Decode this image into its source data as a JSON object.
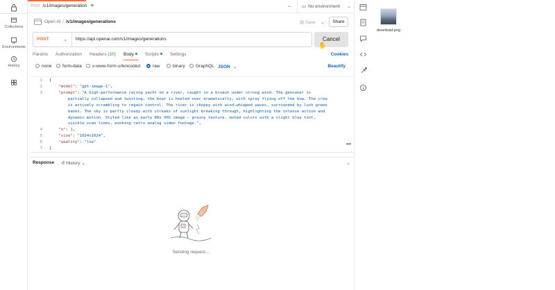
{
  "tabs": [
    {
      "method": "POST",
      "label": "/v1/images/generation"
    }
  ],
  "env": {
    "label": "No environment"
  },
  "rail": {
    "items": [
      {
        "label": "Collections"
      },
      {
        "label": "Environments"
      },
      {
        "label": "History"
      },
      {
        "label": ""
      }
    ]
  },
  "breadcrumb": {
    "workspace": "Open AI",
    "separator": "/",
    "request": "/v1/images/generations"
  },
  "toolbar": {
    "save_label": "Save",
    "share_label": "Share"
  },
  "request": {
    "method": "POST",
    "url": "https://api.openai.com/v1/images/generations",
    "cancel_label": "Cancel"
  },
  "request_tabs": {
    "params": "Params",
    "authorization": "Authorization",
    "headers": "Headers",
    "headers_count": "(10)",
    "body": "Body",
    "scripts": "Scripts",
    "settings": "Settings",
    "cookies": "Cookies"
  },
  "body_options": {
    "none": "none",
    "form_data": "form-data",
    "urlencoded": "x-www-form-urlencoded",
    "raw": "raw",
    "binary": "binary",
    "graphql": "GraphQL",
    "format": "JSON",
    "beautify": "Beautify"
  },
  "editor": {
    "line_numbers": [
      "1",
      "2",
      "3",
      "4",
      "5",
      "6",
      "7"
    ],
    "l1": "{",
    "l2_key": "\"model\"",
    "l2_val": "\"gpt-image-1\"",
    "l3_key": "\"prompt\"",
    "l3_val_1": "\"A high-performance racing yacht on a river, caught in a broach under strong wind. The gennaker is",
    "l3_val_2": "partially collapsed and twisting, the boat is heeled over dramatically, with spray flying off the bow. The crew",
    "l3_val_3": "is actively scrambling to regain control. The river is choppy with wind-whipped waves, surrounded by lush green",
    "l3_val_4": "banks. The sky is partly cloudy with streaks of sunlight breaking through, highlighting the intense action and",
    "l3_val_5": "dynamic motion. Styled like an early 90s VHS image — grainy texture, muted colors with a slight blue tint,",
    "l3_val_6": "visible scan lines, evoking retro analog video footage.\"",
    "l4_key": "\"n\"",
    "l4_val": "1",
    "l5_key": "\"size\"",
    "l5_val": "\"1024x1024\"",
    "l6_key": "\"quality\"",
    "l6_val": "\"low\"",
    "l7": "}"
  },
  "response": {
    "title": "Response",
    "history_label": "History",
    "status": "Sending request..."
  },
  "desktop": {
    "file_name": "download.png"
  },
  "colors": {
    "accent": "#ff6c37",
    "link": "#0a68c4",
    "success": "#2a9a4a"
  }
}
